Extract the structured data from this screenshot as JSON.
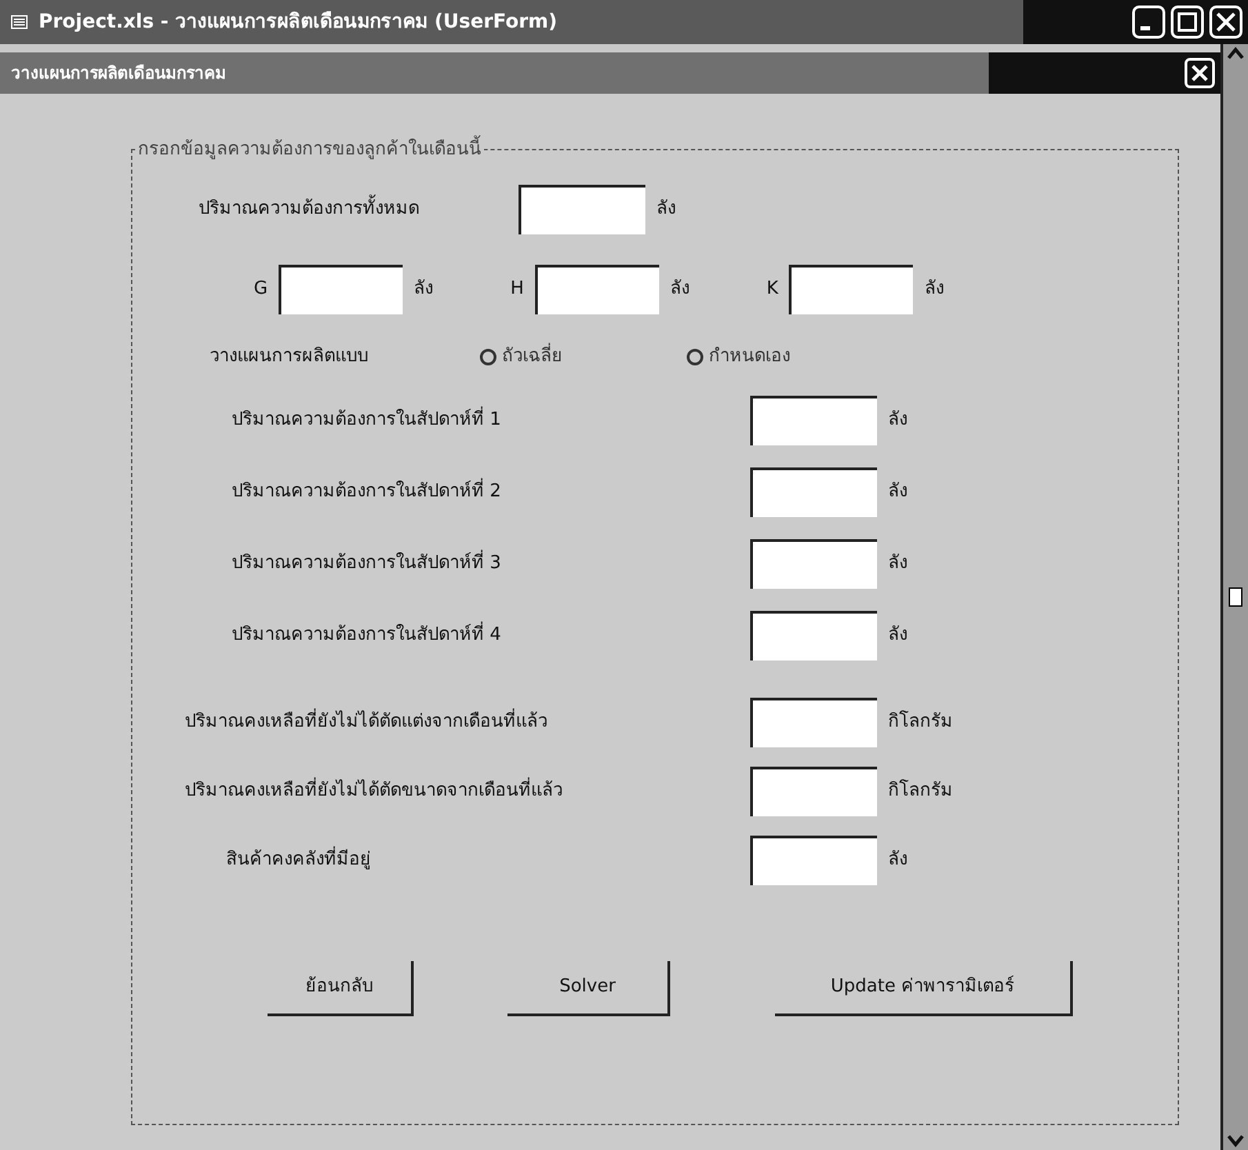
{
  "window": {
    "title": "Project.xls - วางแผนการผลิตเดือนมกราคม (UserForm)"
  },
  "form": {
    "caption": "วางแผนการผลิตเดือนมกราคม"
  },
  "frame": {
    "caption": "กรอกข้อมูลความต้องการของลูกค้าในเดือนนี้"
  },
  "total": {
    "label": "ปริมาณความต้องการทั้งหมด",
    "unit": "ลัง"
  },
  "products": [
    {
      "label": "G",
      "unit": "ลัง"
    },
    {
      "label": "H",
      "unit": "ลัง"
    },
    {
      "label": "K",
      "unit": "ลัง"
    }
  ],
  "plan": {
    "label": "วางแผนการผลิตแบบ",
    "options": [
      {
        "label": "ถัวเฉลี่ย",
        "selected": false
      },
      {
        "label": "กำหนดเอง",
        "selected": false
      }
    ]
  },
  "weeks": [
    {
      "label": "ปริมาณความต้องการในสัปดาห์ที่ 1",
      "unit": "ลัง"
    },
    {
      "label": "ปริมาณความต้องการในสัปดาห์ที่ 2",
      "unit": "ลัง"
    },
    {
      "label": "ปริมาณความต้องการในสัปดาห์ที่ 3",
      "unit": "ลัง"
    },
    {
      "label": "ปริมาณความต้องการในสัปดาห์ที่ 4",
      "unit": "ลัง"
    }
  ],
  "stock": [
    {
      "label": "ปริมาณคงเหลือที่ยังไม่ได้ตัดแต่งจากเดือนที่แล้ว",
      "unit": "กิโลกรัม"
    },
    {
      "label": "ปริมาณคงเหลือที่ยังไม่ได้ตัดขนาดจากเดือนที่แล้ว",
      "unit": "กิโลกรัม"
    },
    {
      "label": "สินค้าคงคลังที่มีอยู่",
      "unit": "ลัง"
    }
  ],
  "buttons": [
    "ย้อนกลับ",
    "Solver",
    "Update ค่าพารามิเตอร์"
  ]
}
